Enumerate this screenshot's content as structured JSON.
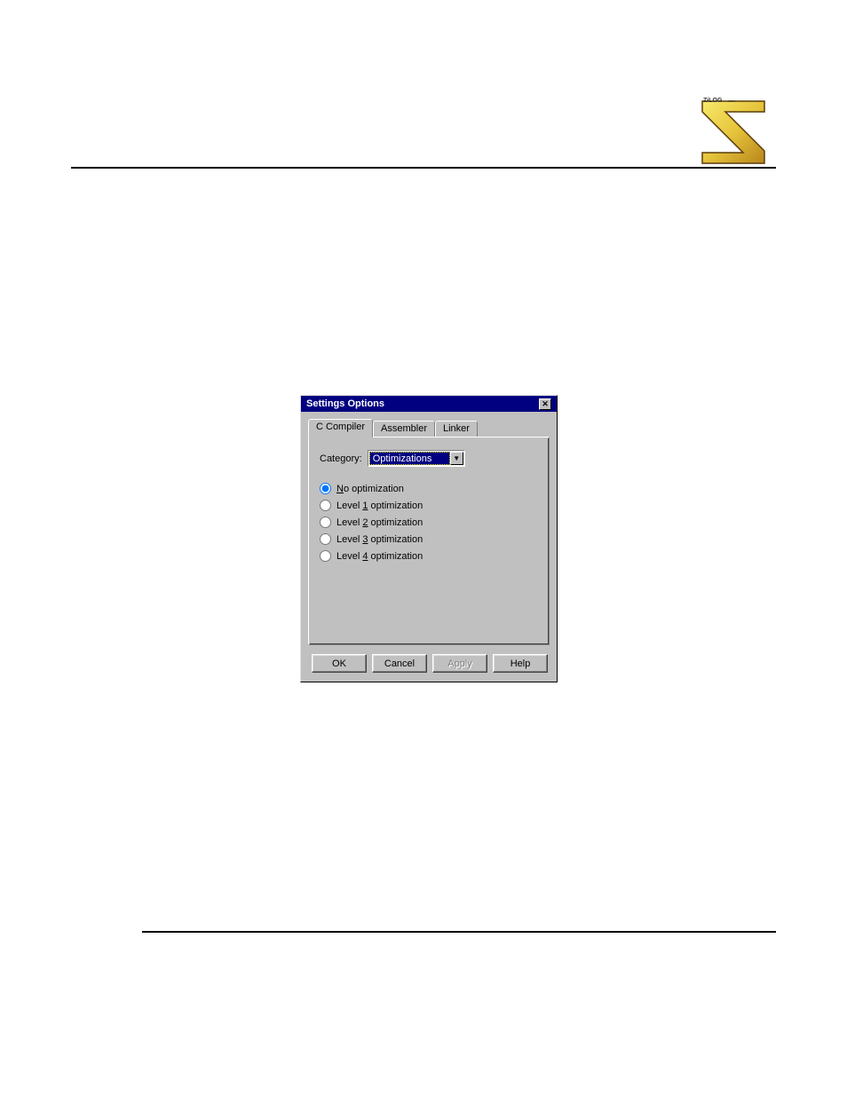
{
  "dialog": {
    "title": "Settings Options",
    "tabs": [
      {
        "label": "C Compiler",
        "active": true
      },
      {
        "label": "Assembler",
        "active": false
      },
      {
        "label": "Linker",
        "active": false
      }
    ],
    "category_label": "Category:",
    "category_value": "Optimizations",
    "radios": [
      {
        "prefix": "",
        "u": "N",
        "suffix": "o optimization",
        "checked": true
      },
      {
        "prefix": "Level ",
        "u": "1",
        "suffix": " optimization",
        "checked": false
      },
      {
        "prefix": "Level ",
        "u": "2",
        "suffix": " optimization",
        "checked": false
      },
      {
        "prefix": "Level ",
        "u": "3",
        "suffix": " optimization",
        "checked": false
      },
      {
        "prefix": "Level ",
        "u": "4",
        "suffix": " optimization",
        "checked": false
      }
    ],
    "buttons": {
      "ok": "OK",
      "cancel": "Cancel",
      "apply": "Apply",
      "help": "Help"
    }
  },
  "colors": {
    "titlebar": "#000080",
    "dialog_bg": "#c0c0c0"
  }
}
